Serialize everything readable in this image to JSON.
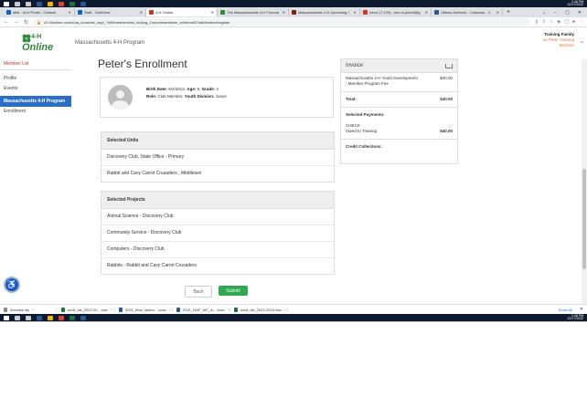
{
  "taskbar_top": {
    "time": "2:46 PM",
    "date": "10/17/2022"
  },
  "tabs": [
    {
      "label": "Mail - Kim Pimell - Outlook",
      "color": "#0a64c6"
    },
    {
      "label": "Staff - OneDrive",
      "color": "#0a64c6"
    },
    {
      "label": "4-H Online",
      "color": "#c0392b",
      "active": true
    },
    {
      "label": "The Massachusetts 4-H Founda",
      "color": "#2e8b3e"
    },
    {
      "label": "Massachusetts 4-H Upcoming I",
      "color": "#8b1a1a"
    },
    {
      "label": "Inbox (7,129) - kim.m.pimell@g",
      "color": "#d93025"
    },
    {
      "label": "UMass Amherst - Calendar - C",
      "color": "#2b579a"
    }
  ],
  "browser": {
    "url": "v2.4honline.com/#/ua_hours/str_cript_?x/ff/member/mbr_kid/prg_1/enrollments/enr_evt/enroll/ClubMember/register"
  },
  "header": {
    "logo_top": "4-H",
    "logo_bottom": "Online",
    "program": "Massachusetts 4-H Program",
    "account_name": "Training Family",
    "account_role": "as Peter Training Member"
  },
  "sidebar": {
    "member_list": "Member List",
    "profile": "Profile",
    "events": "Events",
    "active": "Massachusetts 4-H Program",
    "enrollment": "Enrollment"
  },
  "page": {
    "title": "Peter's Enrollment",
    "birth_label": "Birth Date:",
    "birth_value": "6/4/2013,",
    "age_label": "Age:",
    "age_value": "9,",
    "grade_label": "Grade:",
    "grade_value": "4",
    "role_label": "Role:",
    "role_value": "Club Member,",
    "division_label": "Youth Division:",
    "division_value": "Junior"
  },
  "units": {
    "header": "Selected Units",
    "rows": [
      "Discovery Club, State Office - Primary",
      "Rabbit and Cavy Carrot Crusaders , Middlesex"
    ]
  },
  "projects": {
    "header": "Selected Projects",
    "rows": [
      "Animal Science - Discovery Club",
      "Community Service - Discovery Club",
      "Computers - Discovery Club",
      "Rabbits - Rabbit and Cavy Carrot Crusaders"
    ]
  },
  "buttons": {
    "back": "Back",
    "submit": "Submit"
  },
  "invoice": {
    "title": "Invoice",
    "item_label": "Massachusetts 4-H Youth Development - Member Program Fee",
    "item_amount": "$40.00",
    "total_label": "Total:",
    "total_amount": "$40.00",
    "payments_label": "Selected Payments:",
    "payment_method": "CHECK",
    "owed_label": "Owed to Training",
    "owed_amount": "$40.00",
    "credit_label": "Credit Collections:"
  },
  "downloads": {
    "items": [
      "4honline.zip",
      "ucnit_list_2022-20....xlsx",
      "2021_final_radion....docx",
      "2021_HOF_MC_&....docx",
      "ucnit_list_2022-2023.xlsx"
    ],
    "show_all": "Show all"
  },
  "taskbar_bottom": {
    "time": "2:48 PM",
    "date": "10/17/2022"
  }
}
